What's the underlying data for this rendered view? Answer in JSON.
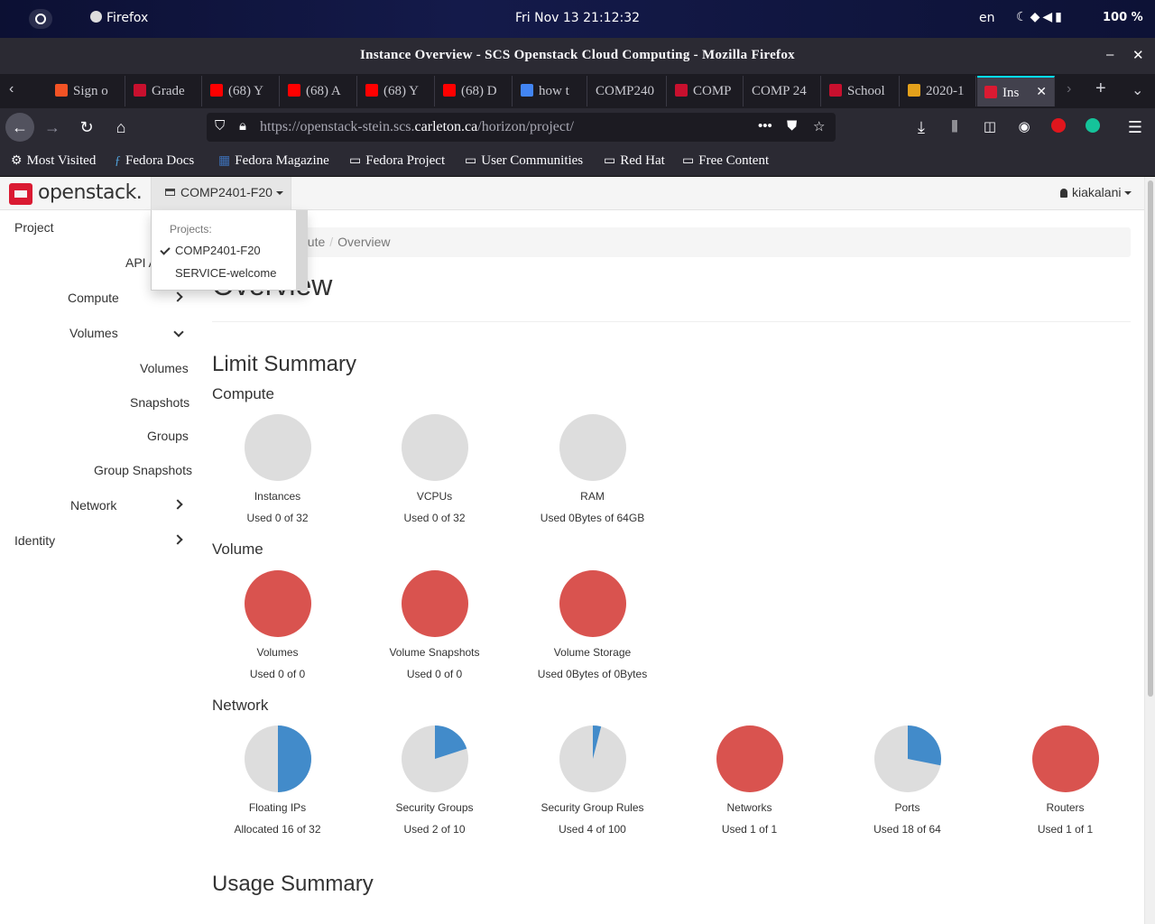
{
  "system_bar": {
    "app_name": "Firefox",
    "clock": "Fri Nov 13  21:12:32",
    "lang": "en",
    "battery_pct": "100 %"
  },
  "window": {
    "title": "Instance Overview - SCS Openstack Cloud Computing - Mozilla Firefox"
  },
  "tabs": [
    {
      "label": "Sign o",
      "color": "#f35325"
    },
    {
      "label": "Grade",
      "color": "#c8102e"
    },
    {
      "label": "(68) Y",
      "color": "#ff0000"
    },
    {
      "label": "(68) A",
      "color": "#ff0000"
    },
    {
      "label": "(68) Y",
      "color": "#ff0000"
    },
    {
      "label": "(68) D",
      "color": "#ff0000"
    },
    {
      "label": "how t",
      "color": "#4285f4"
    },
    {
      "label": "COMP240",
      "color": ""
    },
    {
      "label": "COMP",
      "color": "#c8102e"
    },
    {
      "label": "COMP 24",
      "color": ""
    },
    {
      "label": "School",
      "color": "#c8102e"
    },
    {
      "label": "2020-1",
      "color": "#e4a11b"
    },
    {
      "label": "Ins",
      "color": "#da1a32"
    }
  ],
  "url": {
    "prefix": "https://openstack-stein.scs.",
    "domain": "carleton.ca",
    "path": "/horizon/project/"
  },
  "bookmarks": [
    {
      "label": "Most Visited",
      "icon": "gear-icon"
    },
    {
      "label": "Fedora Docs",
      "icon": "fedora-icon"
    },
    {
      "label": "Fedora Magazine",
      "icon": "fm-icon"
    },
    {
      "label": "Fedora Project",
      "icon": "folder-icon"
    },
    {
      "label": "User Communities",
      "icon": "folder-icon"
    },
    {
      "label": "Red Hat",
      "icon": "folder-icon"
    },
    {
      "label": "Free Content",
      "icon": "folder-icon"
    }
  ],
  "header": {
    "logo_text": "openstack.",
    "project_selector": "COMP2401-F20",
    "user": "kiakalani"
  },
  "project_dropdown": {
    "header": "Projects:",
    "options": [
      "COMP2401-F20",
      "SERVICE-welcome"
    ],
    "selected": "COMP2401-F20"
  },
  "sidebar": {
    "project": "Project",
    "api_access": "API A",
    "compute": "Compute",
    "volumes": "Volumes",
    "volume_items": [
      "Volumes",
      "Snapshots",
      "Groups",
      "Group Snapshots"
    ],
    "network": "Network",
    "identity": "Identity"
  },
  "breadcrumb": {
    "parent": "pute",
    "current": "Overview"
  },
  "page_title": "Overview",
  "limit_summary": {
    "title": "Limit Summary",
    "compute": {
      "title": "Compute",
      "items": [
        {
          "label": "Instances",
          "sub": "Used 0 of 32",
          "fraction": 0,
          "full": false
        },
        {
          "label": "VCPUs",
          "sub": "Used 0 of 32",
          "fraction": 0,
          "full": false
        },
        {
          "label": "RAM",
          "sub": "Used 0Bytes of 64GB",
          "fraction": 0,
          "full": false
        }
      ]
    },
    "volume": {
      "title": "Volume",
      "items": [
        {
          "label": "Volumes",
          "sub": "Used 0 of 0",
          "fraction": 1,
          "full": true
        },
        {
          "label": "Volume Snapshots",
          "sub": "Used 0 of 0",
          "fraction": 1,
          "full": true
        },
        {
          "label": "Volume Storage",
          "sub": "Used 0Bytes of 0Bytes",
          "fraction": 1,
          "full": true
        }
      ]
    },
    "network": {
      "title": "Network",
      "items": [
        {
          "label": "Floating IPs",
          "sub": "Allocated 16 of 32",
          "fraction": 0.5,
          "full": false
        },
        {
          "label": "Security Groups",
          "sub": "Used 2 of 10",
          "fraction": 0.2,
          "full": false
        },
        {
          "label": "Security Group Rules",
          "sub": "Used 4 of 100",
          "fraction": 0.04,
          "full": false
        },
        {
          "label": "Networks",
          "sub": "Used 1 of 1",
          "fraction": 1,
          "full": true
        },
        {
          "label": "Ports",
          "sub": "Used 18 of 64",
          "fraction": 0.28125,
          "full": false
        },
        {
          "label": "Routers",
          "sub": "Used 1 of 1",
          "fraction": 1,
          "full": true
        }
      ]
    }
  },
  "usage_summary": {
    "title": "Usage Summary"
  },
  "colors": {
    "pie_empty": "#dddddd",
    "pie_used": "#428bca",
    "pie_full": "#d9534f"
  }
}
